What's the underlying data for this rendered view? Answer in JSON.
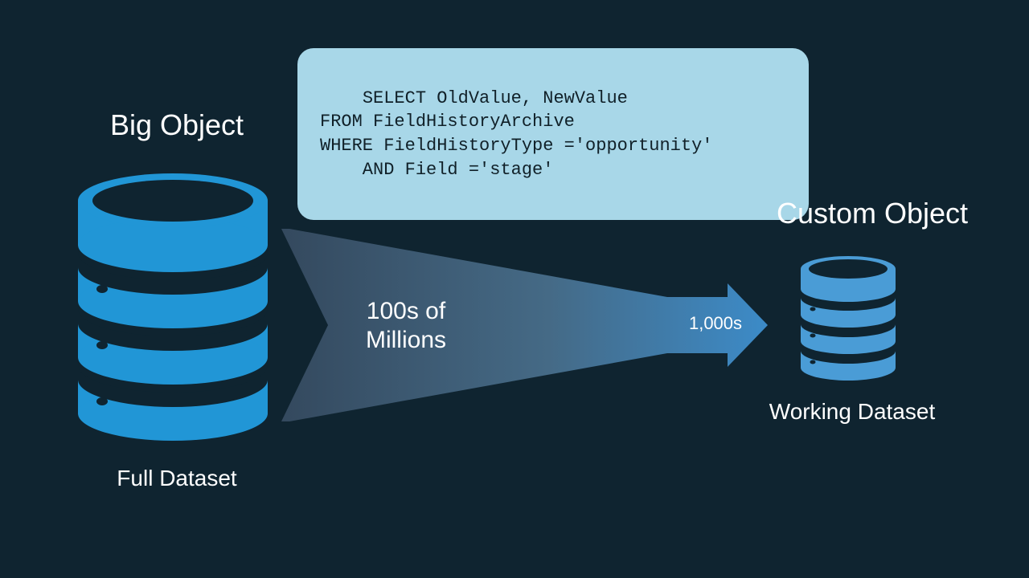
{
  "big_object": {
    "title": "Big Object",
    "caption": "Full Dataset"
  },
  "custom_object": {
    "title": "Custom Object",
    "caption": "Working Dataset"
  },
  "funnel": {
    "left_label": "100s of\nMillions",
    "right_label": "1,000s"
  },
  "code": {
    "text": "SELECT OldValue, NewValue\nFROM FieldHistoryArchive\nWHERE FieldHistoryType ='opportunity'\n    AND Field ='stage'"
  },
  "colors": {
    "bg": "#0f2430",
    "db_blue": "#2196d6",
    "db_blue2": "#4a9cd6",
    "codebox": "#a8d7e8",
    "funnel_dark": "#33485c",
    "funnel_light": "#3c84bd"
  }
}
